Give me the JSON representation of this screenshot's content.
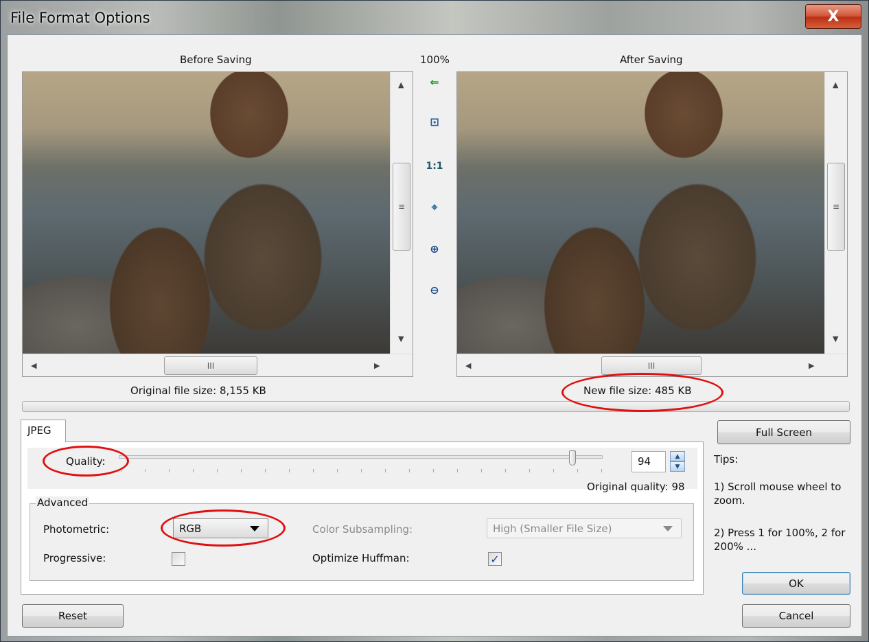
{
  "window": {
    "title": "File Format Options",
    "close_label": "X"
  },
  "preview": {
    "before_title": "Before Saving",
    "after_title": "After Saving",
    "zoom_level": "100%",
    "original_size_label": "Original file size:  8,155 KB",
    "new_size_label": "New file size:  485 KB"
  },
  "tools": [
    {
      "name": "back-arrow-icon",
      "glyph": "⇐",
      "color": "#1a9a1a"
    },
    {
      "name": "fit-window-icon",
      "glyph": "⊡",
      "color": "#1a5a9a"
    },
    {
      "name": "actual-size-icon",
      "glyph": "1:1",
      "color": "#1a5a6a"
    },
    {
      "name": "fit-center-icon",
      "glyph": "⌖",
      "color": "#1a6a9a"
    },
    {
      "name": "zoom-in-icon",
      "glyph": "⊕",
      "color": "#1a4a8a"
    },
    {
      "name": "zoom-out-icon",
      "glyph": "⊖",
      "color": "#1a4a8a"
    }
  ],
  "scroll": {
    "thumb_grip": "III",
    "grip_v": "≡"
  },
  "tab": {
    "label": "JPEG"
  },
  "quality": {
    "label": "Quality:",
    "value": "94",
    "level": 0.94,
    "original": "Original quality: 98"
  },
  "advanced": {
    "title": "Advanced",
    "photometric_label": "Photometric:",
    "photometric_value": "RGB",
    "subsampling_label": "Color Subsampling:",
    "subsampling_value": "High (Smaller File Size)",
    "progressive_label": "Progressive:",
    "progressive_checked": false,
    "huffman_label": "Optimize Huffman:",
    "huffman_checked": true
  },
  "buttons": {
    "full_screen": "Full Screen",
    "ok": "OK",
    "cancel": "Cancel",
    "reset": "Reset"
  },
  "tips": {
    "title": "Tips:",
    "tip1": "1) Scroll mouse wheel to zoom.",
    "tip2": "2) Press 1 for 100%, 2 for 200% ..."
  },
  "colors": {
    "annotation": "#e01010",
    "checkmark": "#1f3f9a"
  }
}
